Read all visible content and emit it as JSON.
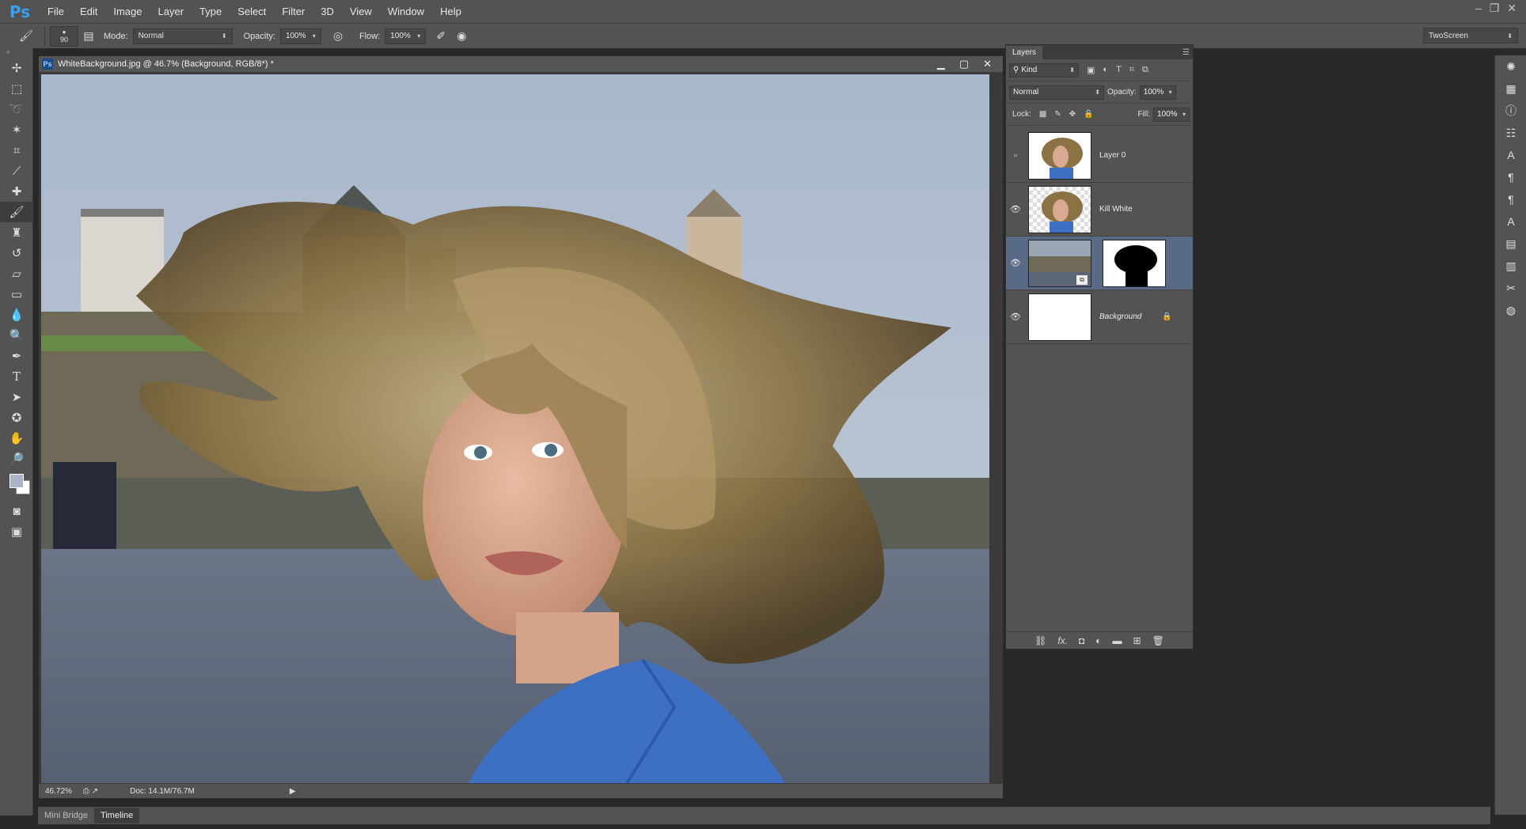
{
  "app": {
    "logo": "Ps"
  },
  "menu": [
    "File",
    "Edit",
    "Image",
    "Layer",
    "Type",
    "Select",
    "Filter",
    "3D",
    "View",
    "Window",
    "Help"
  ],
  "options": {
    "brush_size": "90",
    "mode_label": "Mode:",
    "mode_value": "Normal",
    "opacity_label": "Opacity:",
    "opacity_value": "100%",
    "flow_label": "Flow:",
    "flow_value": "100%",
    "workspace": "TwoScreen"
  },
  "document": {
    "title": "WhiteBackground.jpg @ 46.7% (Background, RGB/8*) *",
    "zoom": "46.72%",
    "doc_size": "Doc: 14.1M/76.7M"
  },
  "layers_panel": {
    "tab": "Layers",
    "kind_label": "Kind",
    "blend_mode": "Normal",
    "opacity_label": "Opacity:",
    "opacity_value": "100%",
    "lock_label": "Lock:",
    "fill_label": "Fill:",
    "fill_value": "100%",
    "layers": [
      {
        "name": "Layer 0",
        "visible": false
      },
      {
        "name": "Kill White",
        "visible": true
      },
      {
        "name": "",
        "visible": true,
        "selected": true
      },
      {
        "name": "Background",
        "visible": true,
        "locked": true
      }
    ]
  },
  "bottom_tabs": [
    "Mini Bridge",
    "Timeline"
  ],
  "colors": {
    "accent": "#596a85",
    "chrome": "#535353",
    "shirt": "#3d6fc2"
  }
}
